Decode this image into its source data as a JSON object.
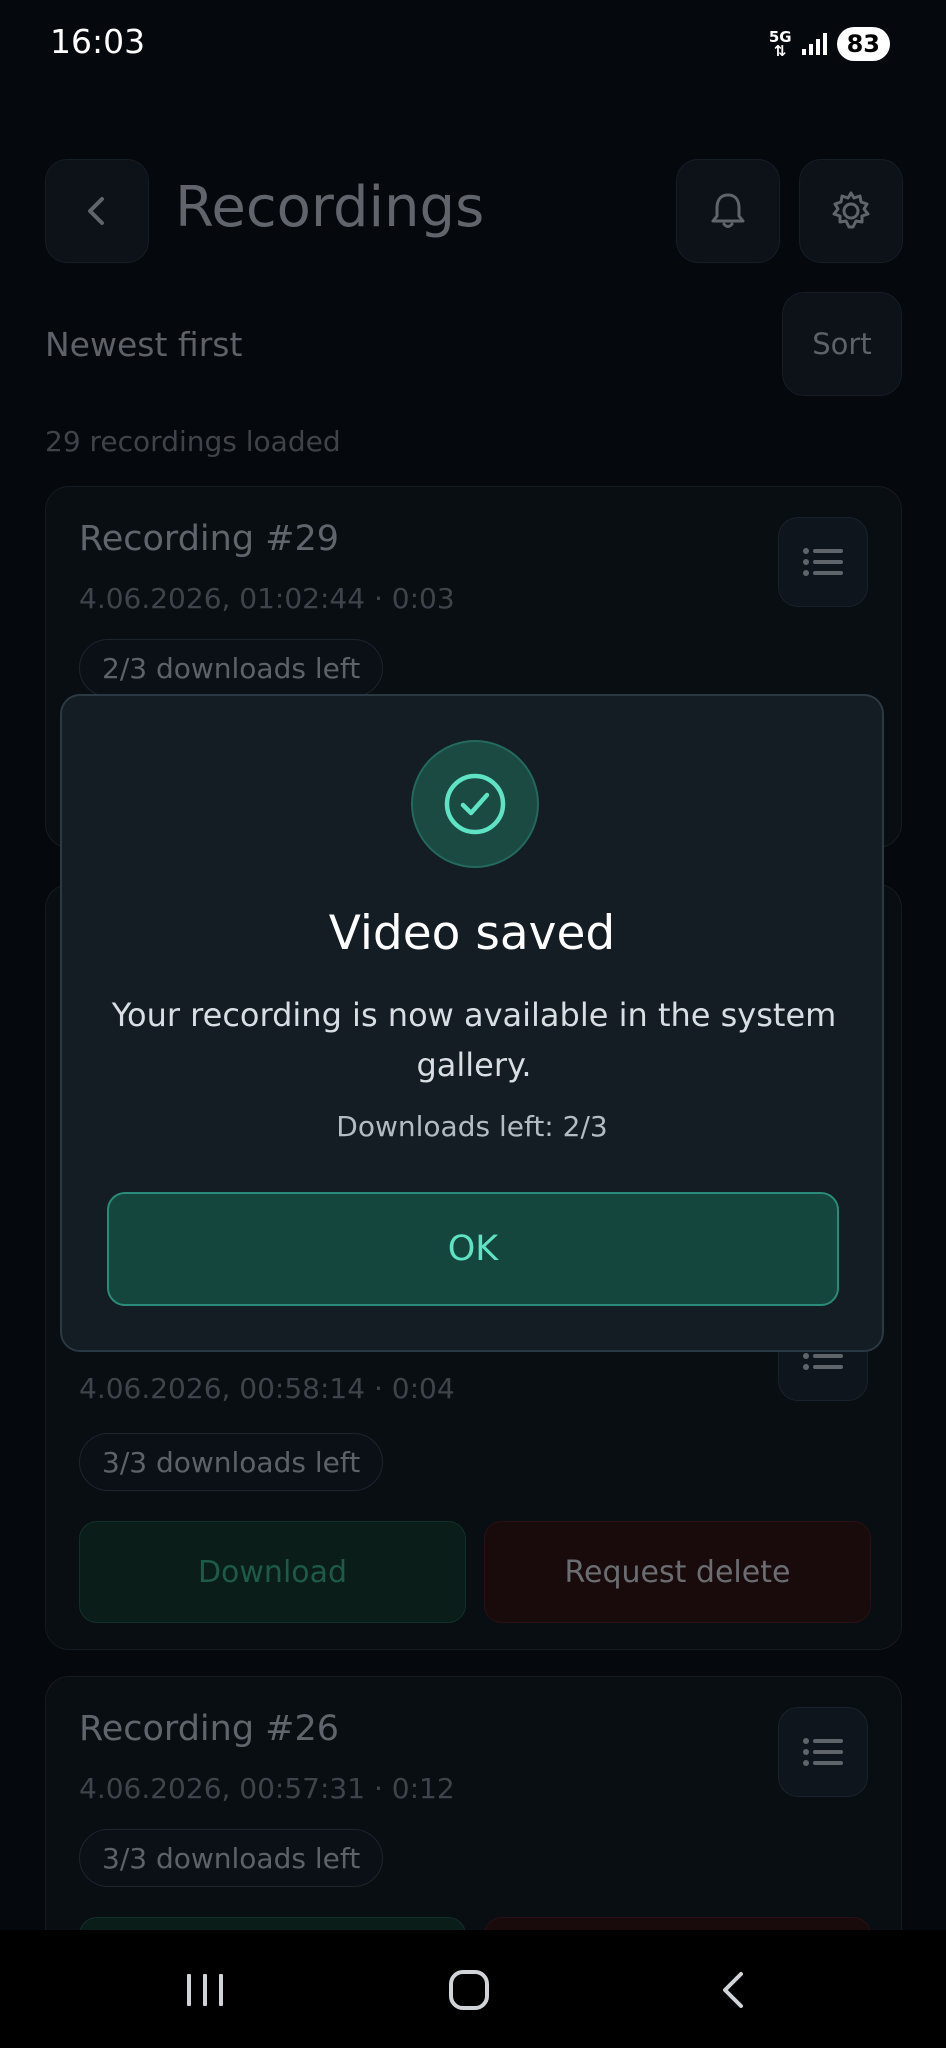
{
  "status_bar": {
    "time": "16:03",
    "network": "5G",
    "battery": "83"
  },
  "header": {
    "title": "Recordings",
    "back_icon": "chevron-left-icon",
    "bell_icon": "bell-icon",
    "settings_icon": "gear-icon"
  },
  "sort": {
    "label": "Newest first",
    "button": "Sort"
  },
  "loaded_count": "29 recordings loaded",
  "recordings": [
    {
      "title": "Recording #29",
      "meta": "4.06.2026, 01:02:44 · 0:03",
      "downloads_badge": "2/3 downloads left"
    },
    {
      "title": "",
      "meta": "4.06.2026, 00:58:14 · 0:04",
      "downloads_badge": "3/3 downloads left",
      "download_label": "Download",
      "delete_label": "Request delete"
    },
    {
      "title": "Recording #26",
      "meta": "4.06.2026, 00:57:31 · 0:12",
      "downloads_badge": "3/3 downloads left"
    }
  ],
  "dialog": {
    "icon": "check-circle-icon",
    "title": "Video saved",
    "message": "Your recording is now available in the system gallery.",
    "downloads": "Downloads left: 2/3",
    "ok_label": "OK"
  },
  "colors": {
    "background": "#05080c",
    "dialog_background": "#141c24",
    "accent": "#5ee3c4",
    "accent_dark": "#14463d",
    "delete_red": "#190a0c"
  },
  "nav_bar": {
    "recents_icon": "recents-icon",
    "home_icon": "home-icon",
    "back_icon": "back-icon"
  }
}
